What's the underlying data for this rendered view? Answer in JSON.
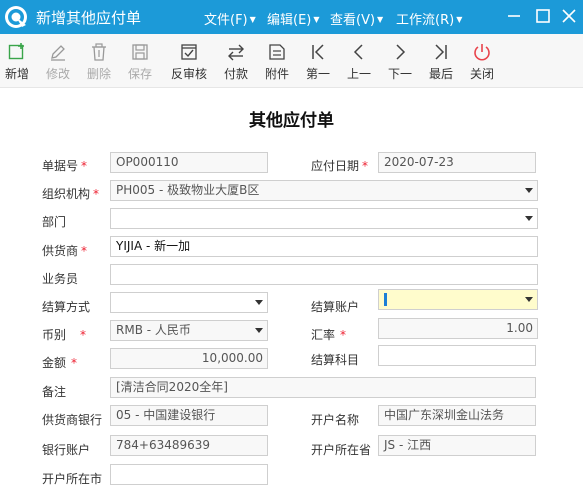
{
  "window": {
    "title": "新增其他应付单",
    "menus": [
      {
        "label": "文件(F)"
      },
      {
        "label": "编辑(E)"
      },
      {
        "label": "查看(V)"
      },
      {
        "label": "工作流(R)"
      }
    ]
  },
  "toolbar": {
    "buttons": [
      {
        "label": "新增",
        "icon": "add-icon",
        "enabled": true
      },
      {
        "label": "修改",
        "icon": "edit-icon",
        "enabled": false
      },
      {
        "label": "删除",
        "icon": "trash-icon",
        "enabled": false
      },
      {
        "label": "保存",
        "icon": "save-icon",
        "enabled": false
      },
      {
        "label": "反审核",
        "icon": "unapprove-icon",
        "enabled": true
      },
      {
        "label": "付款",
        "icon": "transfer-icon",
        "enabled": true
      },
      {
        "label": "附件",
        "icon": "attachment-icon",
        "enabled": true
      },
      {
        "label": "第一",
        "icon": "first-icon",
        "enabled": true
      },
      {
        "label": "上一",
        "icon": "prev-icon",
        "enabled": true
      },
      {
        "label": "下一",
        "icon": "next-icon",
        "enabled": true
      },
      {
        "label": "最后",
        "icon": "last-icon",
        "enabled": true
      },
      {
        "label": "关闭",
        "icon": "power-icon",
        "enabled": true
      }
    ]
  },
  "form": {
    "title": "其他应付单",
    "fields": {
      "bill_no": {
        "label": "单据号",
        "value": "OP000110"
      },
      "pay_date": {
        "label": "应付日期",
        "value": "2020-07-23"
      },
      "org": {
        "label": "组织机构",
        "value": "PH005 - 极致物业大厦B区"
      },
      "dept": {
        "label": "部门",
        "value": ""
      },
      "supplier": {
        "label": "供货商",
        "value": "YIJIA - 新一加"
      },
      "salesman": {
        "label": "业务员",
        "value": ""
      },
      "settle_method": {
        "label": "结算方式",
        "value": ""
      },
      "settle_account": {
        "label": "结算账户",
        "value": ""
      },
      "currency": {
        "label": "币别",
        "value": "RMB - 人民币"
      },
      "rate": {
        "label": "汇率",
        "value": "1.00"
      },
      "amount": {
        "label": "金额",
        "value": "10,000.00"
      },
      "settle_subject": {
        "label": "结算科目",
        "value": ""
      },
      "remark": {
        "label": "备注",
        "value": "[清洁合同2020全年]"
      },
      "supplier_bank": {
        "label": "供货商银行",
        "value": "05 - 中国建设银行"
      },
      "account_name": {
        "label": "开户名称",
        "value": "中国广东深圳金山法务"
      },
      "bank_account": {
        "label": "银行账户",
        "value": "784+63489639"
      },
      "bank_province": {
        "label": "开户所在省",
        "value": "JS - 江西"
      },
      "bank_city": {
        "label": "开户所在市",
        "value": ""
      }
    }
  },
  "colors": {
    "titlebar": "#1c9ad8",
    "required": "#e23333",
    "close_icon": "#e8434b"
  }
}
